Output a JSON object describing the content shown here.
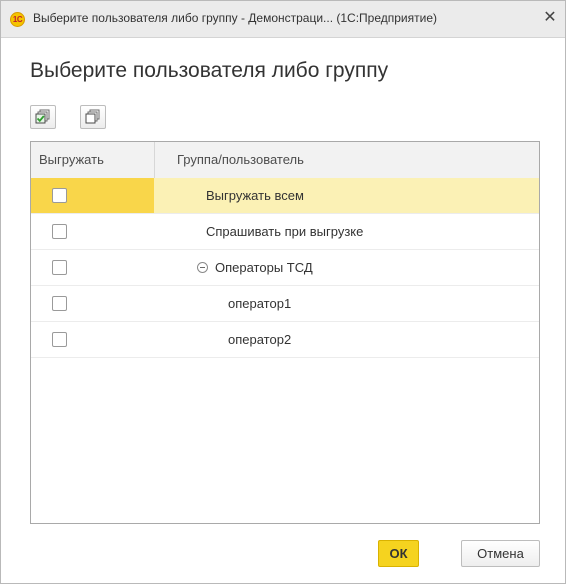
{
  "window": {
    "app_badge": "1С",
    "title": "Выберите пользователя либо группу - Демонстраци... (1С:Предприятие)",
    "close_glyph": "✕"
  },
  "header": {
    "title": "Выберите пользователя либо группу"
  },
  "toolbar": {
    "check_all_icon": "check-all-icon",
    "uncheck_all_icon": "uncheck-all-icon"
  },
  "table": {
    "columns": [
      "Выгружать",
      "Группа/пользователь"
    ],
    "rows": [
      {
        "checked": false,
        "label": "Выгружать всем",
        "selected": true
      },
      {
        "checked": false,
        "label": "Спрашивать при выгрузке",
        "selected": false
      },
      {
        "checked": false,
        "label": "Операторы ТСД",
        "selected": false,
        "expanded": true
      },
      {
        "checked": false,
        "label": "оператор1",
        "selected": false
      },
      {
        "checked": false,
        "label": "оператор2",
        "selected": false
      }
    ]
  },
  "footer": {
    "ok_label": "ОК",
    "cancel_label": "Отмена"
  },
  "colors": {
    "accent": "#f5d31f",
    "selected_row": "#fbf1b5",
    "selected_cell": "#f9d64a"
  }
}
